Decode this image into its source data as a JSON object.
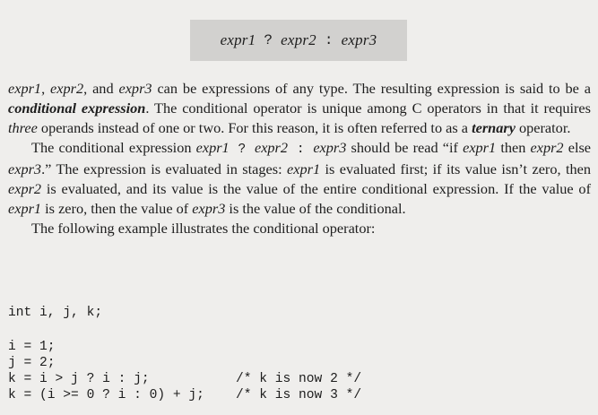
{
  "syntax": {
    "expr1": "expr1",
    "op1": "?",
    "expr2": "expr2",
    "op2": ":",
    "expr3": "expr3"
  },
  "para1": {
    "t1": "expr1",
    "t2": ", ",
    "t3": "expr2",
    "t4": ", and ",
    "t5": "expr3",
    "t6": " can be expressions of any type. The resulting expression is said to be a ",
    "t7": "conditional expression",
    "t8": ". The conditional operator is unique among C operators in that it requires ",
    "t9": "three",
    "t10": " operands instead of one or two. For this reason, it is often referred to as a ",
    "t11": "ternary",
    "t12": " operator."
  },
  "para2": {
    "t1": "The conditional expression ",
    "t2": "expr1",
    "t3": " ? ",
    "t4": "expr2",
    "t5": " : ",
    "t6": "expr3",
    "t7": " should be read “if ",
    "t8": "expr1",
    "t9": " then ",
    "t10": "expr2",
    "t11": " else ",
    "t12": "expr3",
    "t13": ".” The expression is evaluated in stages: ",
    "t14": "expr1",
    "t15": " is evaluated first; if its value isn’t zero, then ",
    "t16": "expr2",
    "t17": " is evaluated, and its value is the value of the entire conditional expression. If the value of ",
    "t18": "expr1",
    "t19": " is zero, then the value of ",
    "t20": "expr3",
    "t21": " is the value of the conditional."
  },
  "para3": "The following example illustrates the conditional operator:",
  "code": [
    "int i, j, k;",
    "i = 1;",
    "j = 2;",
    "k = i > j ? i : j;           /* k is now 2 */",
    "k = (i >= 0 ? i : 0) + j;    /* k is now 3 */"
  ]
}
